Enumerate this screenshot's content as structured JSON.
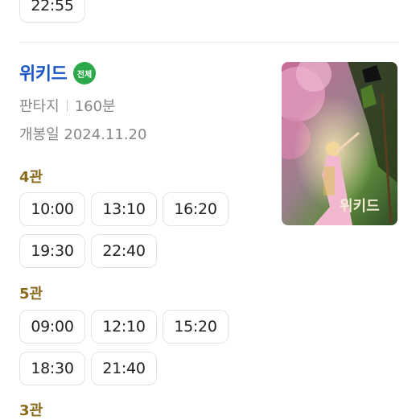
{
  "previous": {
    "last_time": "22:55"
  },
  "movie": {
    "title": "위키드",
    "rating_badge": "전체",
    "genre": "판타지",
    "runtime": "160분",
    "release": "개봉일 2024.11.20",
    "poster_text": "위키드"
  },
  "halls": [
    {
      "name": "4관",
      "times": [
        "10:00",
        "13:10",
        "16:20",
        "19:30",
        "22:40"
      ]
    },
    {
      "name": "5관",
      "times": [
        "09:00",
        "12:10",
        "15:20",
        "18:30",
        "21:40"
      ]
    },
    {
      "name": "3관",
      "times": []
    }
  ],
  "colors": {
    "title": "#1a55c8",
    "badge": "#2aa84a",
    "hall": "#8a6a1c"
  }
}
